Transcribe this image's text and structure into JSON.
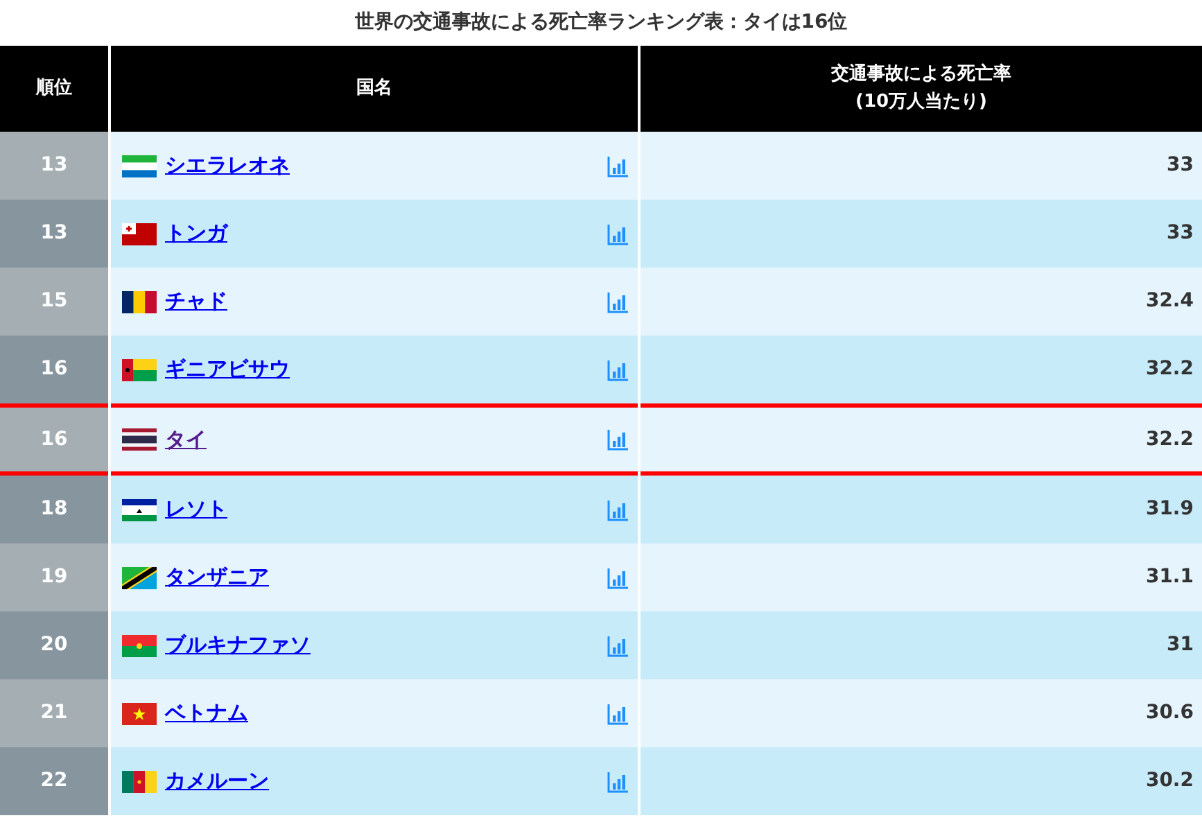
{
  "title": "世界の交通事故による死亡率ランキング表：タイは16位",
  "columns": [
    "順位",
    "国名",
    "交通事故による死亡率\n(10万人当たり)"
  ],
  "rows": [
    {
      "rank": "13",
      "country": "シエラレオネ",
      "value": "33",
      "highlighted": false,
      "visited": false
    },
    {
      "rank": "13",
      "country": "トンガ",
      "value": "33",
      "highlighted": false,
      "visited": false
    },
    {
      "rank": "15",
      "country": "チャド",
      "value": "32.4",
      "highlighted": false,
      "visited": false
    },
    {
      "rank": "16",
      "country": "ギニアビサウ",
      "value": "32.2",
      "highlighted": false,
      "visited": false
    },
    {
      "rank": "16",
      "country": "タイ",
      "value": "32.2",
      "highlighted": true,
      "visited": true
    },
    {
      "rank": "18",
      "country": "レソト",
      "value": "31.9",
      "highlighted": false,
      "visited": false
    },
    {
      "rank": "19",
      "country": "タンザニア",
      "value": "31.1",
      "highlighted": false,
      "visited": false
    },
    {
      "rank": "20",
      "country": "ブルキナファソ",
      "value": "31",
      "highlighted": false,
      "visited": false
    },
    {
      "rank": "21",
      "country": "ベトナム",
      "value": "30.6",
      "highlighted": false,
      "visited": false
    },
    {
      "rank": "22",
      "country": "カメルーン",
      "value": "30.2",
      "highlighted": false,
      "visited": false
    }
  ]
}
